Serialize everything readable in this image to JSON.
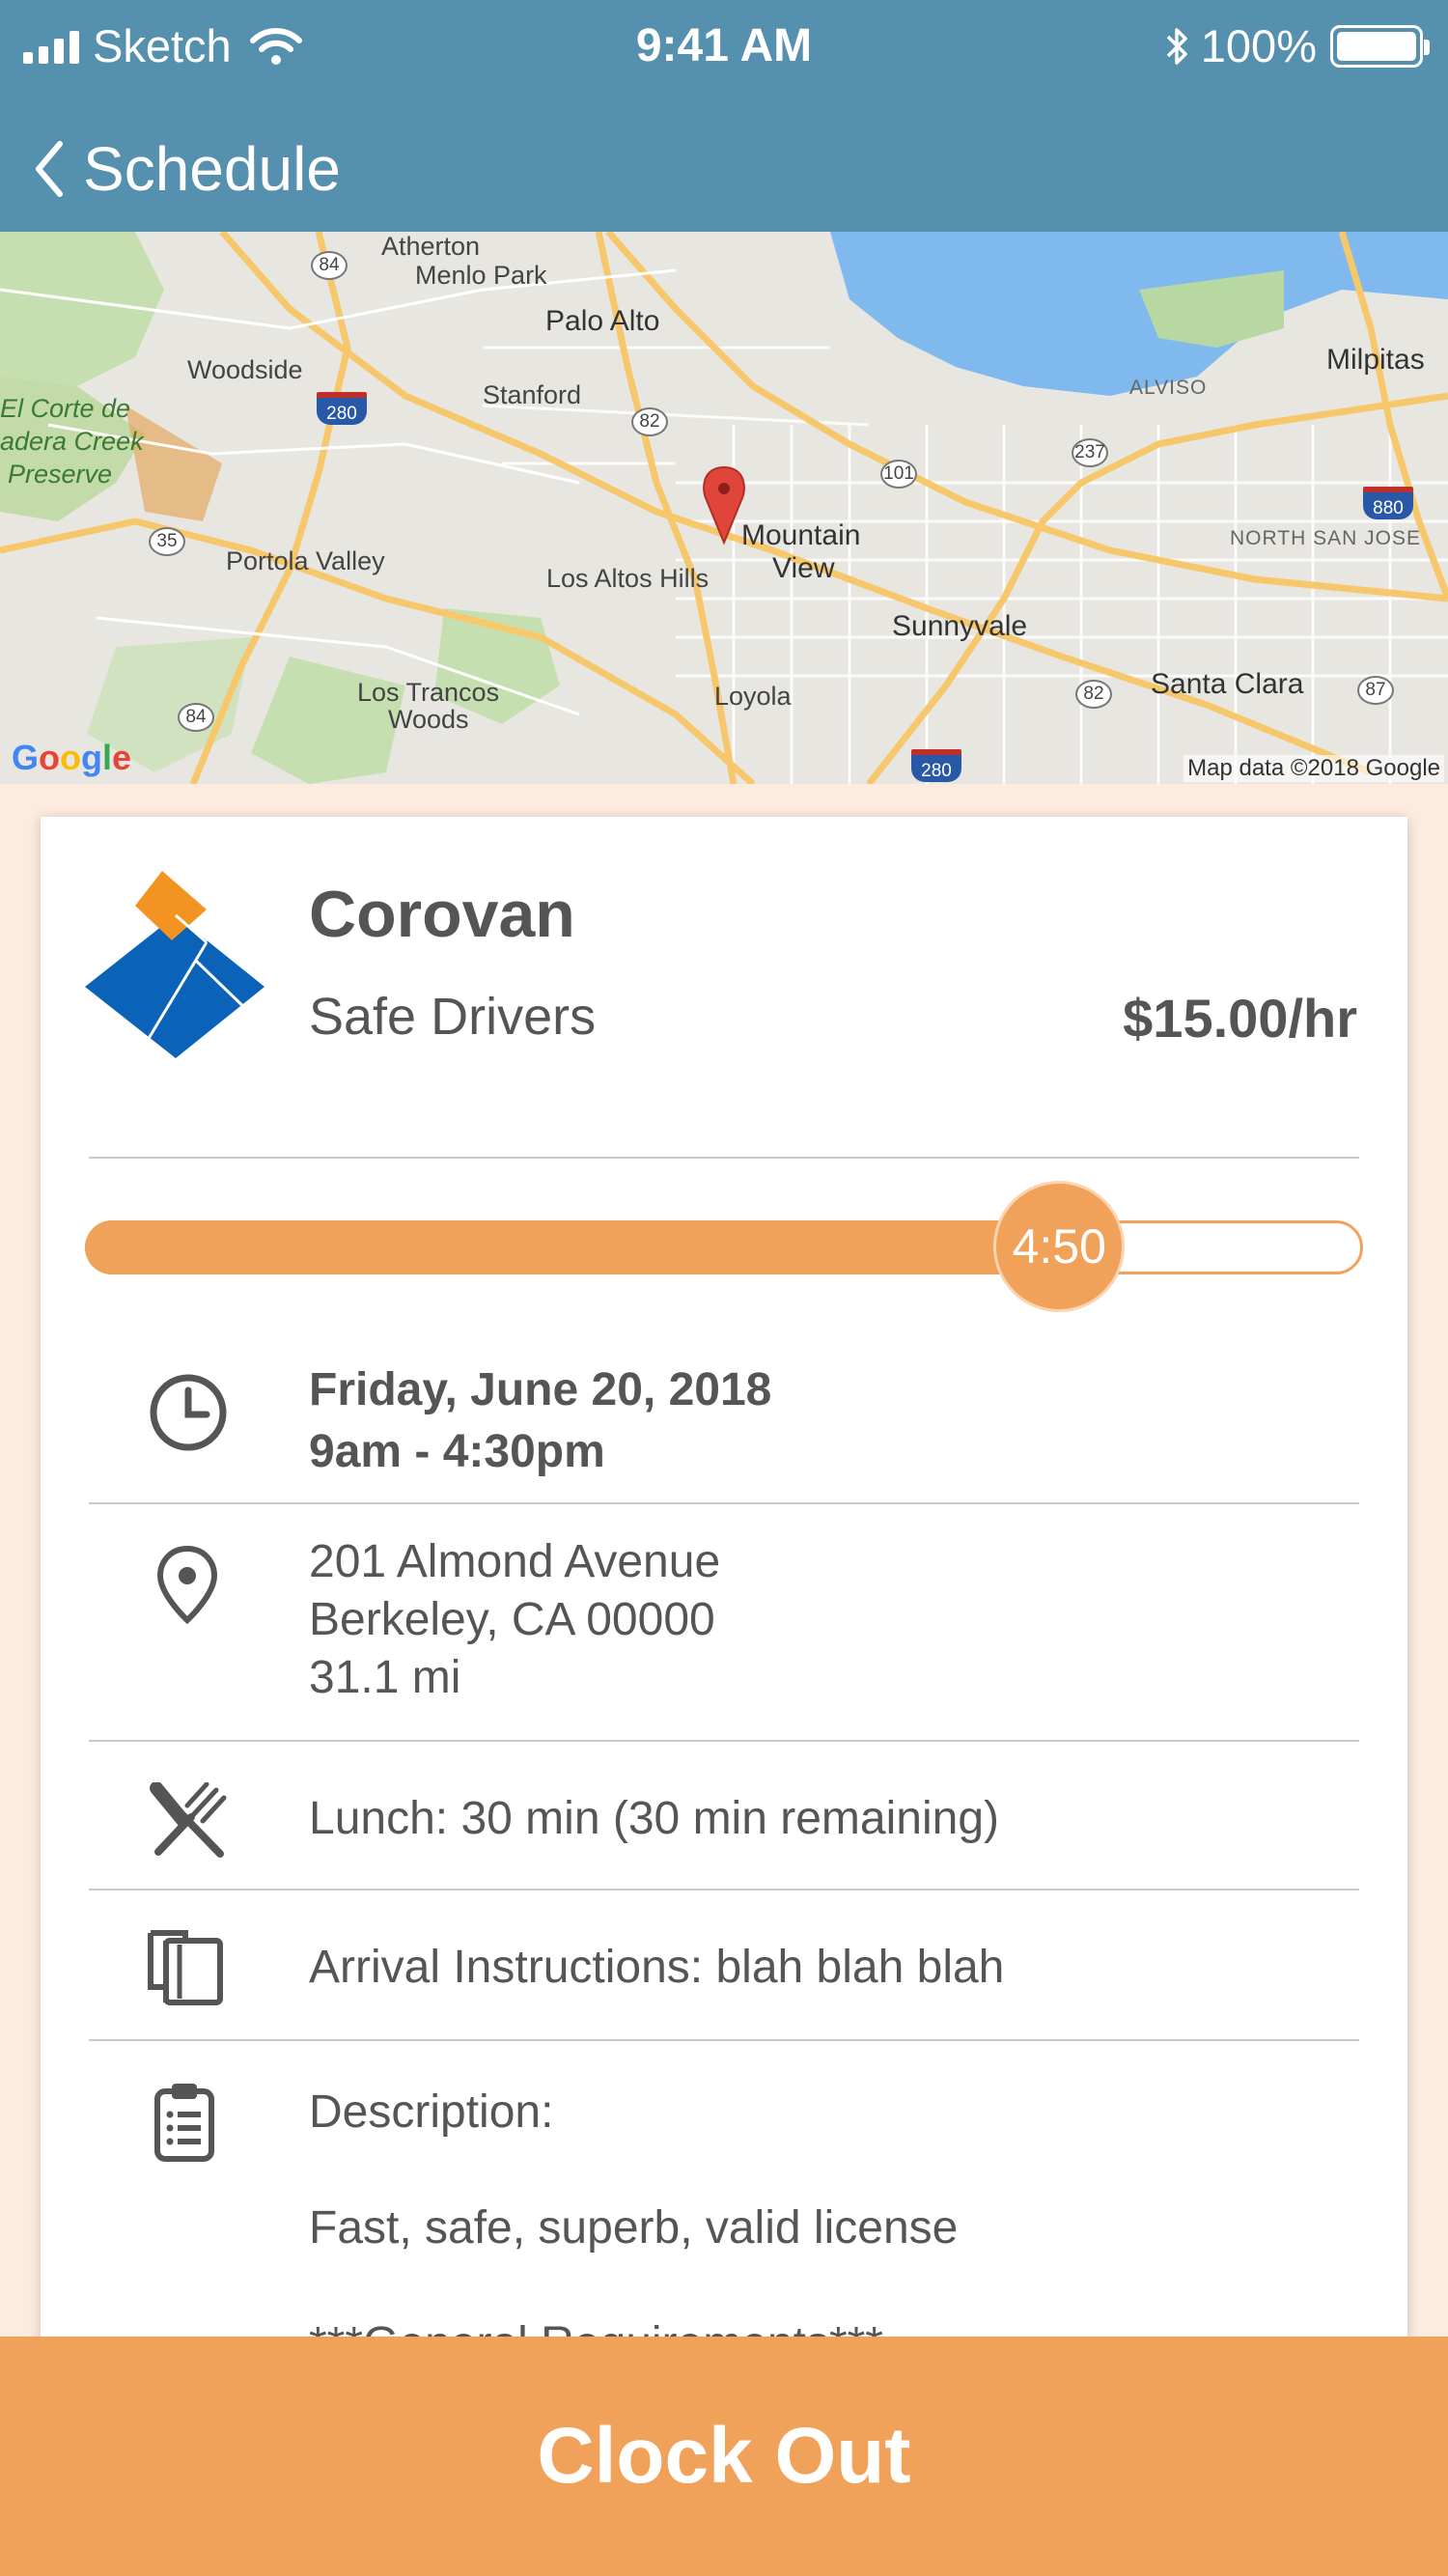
{
  "status_bar": {
    "carrier": "Sketch",
    "time": "9:41 AM",
    "battery_percent": "100%",
    "icons": [
      "signal-icon",
      "wifi-icon",
      "bluetooth-icon",
      "battery-icon"
    ]
  },
  "nav": {
    "back_label": "Schedule"
  },
  "map": {
    "labels": {
      "atherton": "Atherton",
      "menlo_park": "Menlo Park",
      "palo_alto": "Palo Alto",
      "woodside": "Woodside",
      "stanford": "Stanford",
      "el_corte": "El Corte de",
      "madera": "adera Creek",
      "preserve": "Preserve",
      "portola_valley": "Portola Valley",
      "los_altos_hills": "Los Altos Hills",
      "mountain": "Mountain",
      "view": "View",
      "los_trancos": "Los Trancos",
      "woods": "Woods",
      "loyola": "Loyola",
      "sunnyvale": "Sunnyvale",
      "santa_clara": "Santa Clara",
      "milpitas": "Milpitas",
      "alviso": "ALVISO",
      "north_san_jose": "NORTH SAN JOSE"
    },
    "shields": {
      "r84a": "84",
      "r280a": "280",
      "r82a": "82",
      "r101": "101",
      "r237": "237",
      "r880": "880",
      "r35": "35",
      "r84b": "84",
      "r82b": "82",
      "r87": "87",
      "r280b": "280"
    },
    "google": "Google",
    "attribution": "Map data ©2018 Google",
    "pin_icon": "map-pin-icon"
  },
  "job": {
    "company": "Corovan",
    "title": "Safe Drivers",
    "rate": "$15.00/hr"
  },
  "progress": {
    "label": "4:50",
    "fraction": 0.76
  },
  "details": {
    "date": "Friday, June 20, 2018",
    "time_range": "9am - 4:30pm",
    "address_line1": "201 Almond Avenue",
    "address_line2": "Berkeley, CA 00000",
    "distance": "31.1 mi",
    "lunch": "Lunch: 30 min (30 min remaining)",
    "arrival": "Arrival Instructions: blah blah blah",
    "description_label": "Description:",
    "description_text": "Fast, safe, superb, valid license",
    "requirements_partial": "***General Requirements***"
  },
  "actions": {
    "clock_out": "Clock Out"
  },
  "colors": {
    "header": "#5690af",
    "accent": "#f0a25b",
    "background": "#fcebde",
    "logo_blue": "#0a63b8",
    "logo_orange": "#f39322"
  }
}
